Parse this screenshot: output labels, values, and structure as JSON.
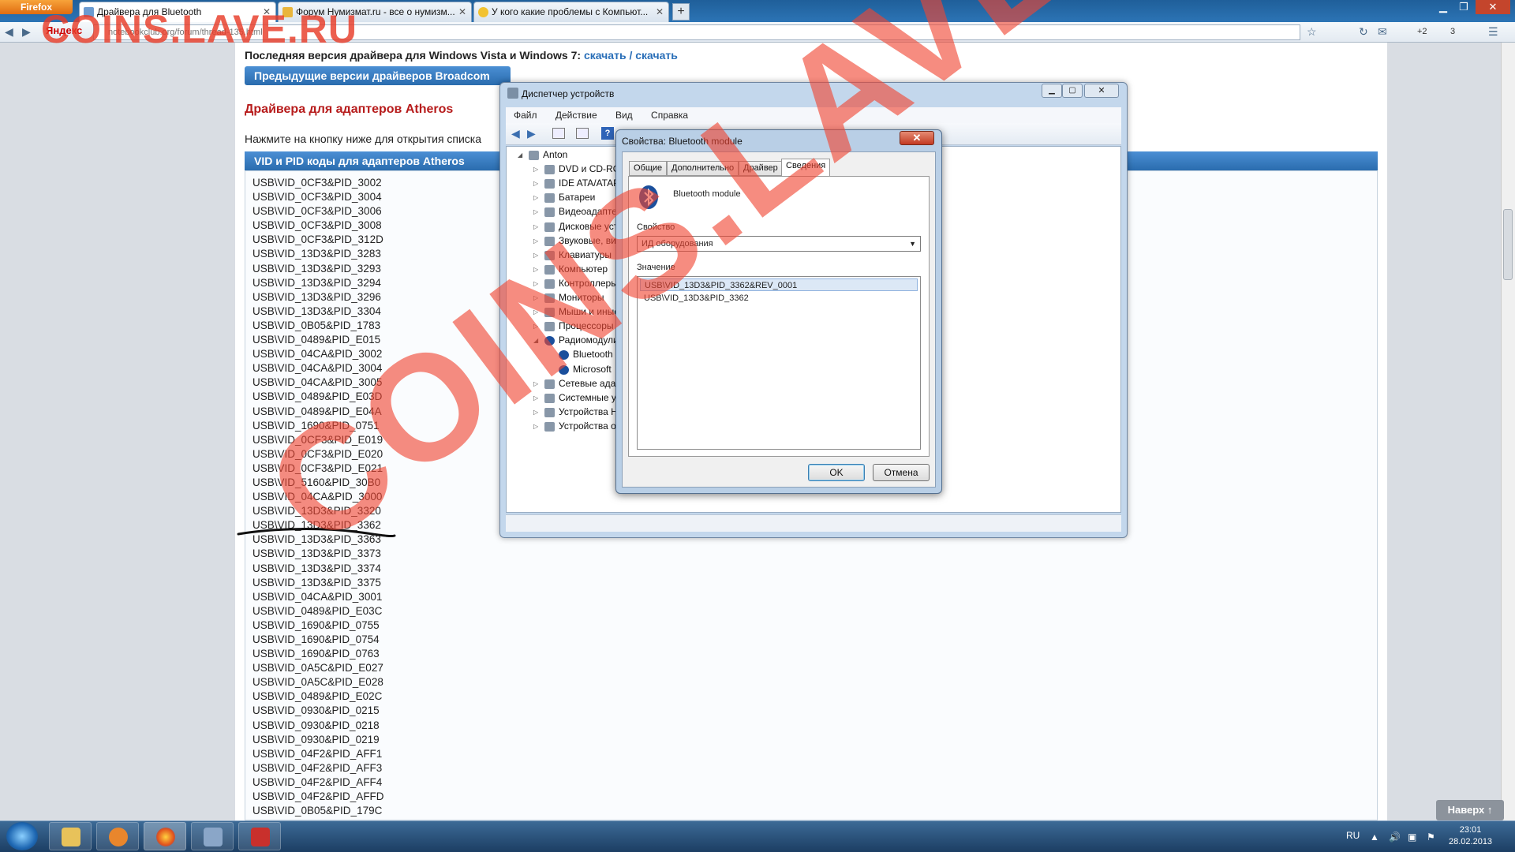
{
  "browser": {
    "menu_button": "Firefox",
    "tabs": [
      {
        "label": "Драйвера для Bluetooth",
        "active": true
      },
      {
        "label": "Форум Нумизмат.ru - все о нумизм...",
        "active": false
      },
      {
        "label": "У кого какие проблемы с Компьют...",
        "active": false
      }
    ],
    "new_tab": "+",
    "search_engine": "Яндекс",
    "url": "notebookclub.org/forum/thread-135.html",
    "toolbar_badges": {
      "plus": "+2",
      "count": "3"
    }
  },
  "page": {
    "latest_label": "Последняя версия драйвера для Windows Vista и Windows 7:",
    "download1": "скачать",
    "separator": "/",
    "download2": "скачать",
    "prev_button": "Предыдущие версии драйверов Broadcom",
    "atheros_heading": "Драйвера для адаптеров Atheros",
    "press_text": "Нажмите на кнопку ниже для открытия списка",
    "vid_bar": "VID и PID коды для адаптеров Atheros",
    "vid_list": [
      "USB\\VID_0CF3&PID_3002",
      "USB\\VID_0CF3&PID_3004",
      "USB\\VID_0CF3&PID_3006",
      "USB\\VID_0CF3&PID_3008",
      "USB\\VID_0CF3&PID_312D",
      "USB\\VID_13D3&PID_3283",
      "USB\\VID_13D3&PID_3293",
      "USB\\VID_13D3&PID_3294",
      "USB\\VID_13D3&PID_3296",
      "USB\\VID_13D3&PID_3304",
      "USB\\VID_0B05&PID_1783",
      "USB\\VID_0489&PID_E015",
      "USB\\VID_04CA&PID_3002",
      "USB\\VID_04CA&PID_3004",
      "USB\\VID_04CA&PID_3005",
      "USB\\VID_0489&PID_E03D",
      "USB\\VID_0489&PID_E04A",
      "USB\\VID_1690&PID_0751",
      "USB\\VID_0CF3&PID_E019",
      "USB\\VID_0CF3&PID_E020",
      "USB\\VID_0CF3&PID_E021",
      "USB\\VID_5160&PID_30B0",
      "USB\\VID_04CA&PID_3000",
      "USB\\VID_13D3&PID_3320",
      "USB\\VID_13D3&PID_3362",
      "USB\\VID_13D3&PID_3363",
      "USB\\VID_13D3&PID_3373",
      "USB\\VID_13D3&PID_3374",
      "USB\\VID_13D3&PID_3375",
      "USB\\VID_04CA&PID_3001",
      "USB\\VID_0489&PID_E03C",
      "USB\\VID_1690&PID_0755",
      "USB\\VID_1690&PID_0754",
      "USB\\VID_1690&PID_0763",
      "USB\\VID_0A5C&PID_E027",
      "USB\\VID_0A5C&PID_E028",
      "USB\\VID_0489&PID_E02C",
      "USB\\VID_0930&PID_0215",
      "USB\\VID_0930&PID_0218",
      "USB\\VID_0930&PID_0219",
      "USB\\VID_04F2&PID_AFF1",
      "USB\\VID_04F2&PID_AFF3",
      "USB\\VID_04F2&PID_AFF4",
      "USB\\VID_04F2&PID_AFFD",
      "USB\\VID_0B05&PID_179C"
    ],
    "scroll_top_button": "Наверх ↑"
  },
  "device_manager": {
    "title": "Диспетчер устройств",
    "menu": [
      "Файл",
      "Действие",
      "Вид",
      "Справка"
    ],
    "tree": [
      {
        "label": "Anton",
        "level": 0
      },
      {
        "label": "DVD и CD-RO",
        "level": 1
      },
      {
        "label": "IDE ATA/ATAP",
        "level": 1
      },
      {
        "label": "Батареи",
        "level": 1
      },
      {
        "label": "Видеоадаптер",
        "level": 1
      },
      {
        "label": "Дисковые уст",
        "level": 1
      },
      {
        "label": "Звуковые, вид",
        "level": 1
      },
      {
        "label": "Клавиатуры",
        "level": 1
      },
      {
        "label": "Компьютер",
        "level": 1
      },
      {
        "label": "Контроллеры",
        "level": 1
      },
      {
        "label": "Мониторы",
        "level": 1
      },
      {
        "label": "Мыши и иные",
        "level": 1
      },
      {
        "label": "Процессоры",
        "level": 1
      },
      {
        "label": "Радиомодули",
        "level": 1
      },
      {
        "label": "Bluetooth",
        "level": 2
      },
      {
        "label": "Microsoft",
        "level": 2
      },
      {
        "label": "Сетевые адап",
        "level": 1
      },
      {
        "label": "Системные у",
        "level": 1
      },
      {
        "label": "Устройства H",
        "level": 1
      },
      {
        "label": "Устройства о",
        "level": 1
      }
    ]
  },
  "properties_dialog": {
    "title": "Свойства: Bluetooth module",
    "close": "✕",
    "tabs": [
      "Общие",
      "Дополнительно",
      "Драйвер",
      "Сведения"
    ],
    "active_tab": "Сведения",
    "device_name": "Bluetooth module",
    "property_label": "Свойство",
    "property_value": "ИД оборудования",
    "value_label": "Значение",
    "values": [
      "USB\\VID_13D3&PID_3362&REV_0001",
      "USB\\VID_13D3&PID_3362"
    ],
    "ok": "OK",
    "cancel": "Отмена"
  },
  "taskbar": {
    "lang": "RU",
    "time": "23:01",
    "date": "28.02.2013"
  },
  "watermark": {
    "top": "COINS.LAVE.RU",
    "big": "COINS.LAVE.RU"
  },
  "colors": {
    "accent": "#2a6cae",
    "heading_red": "#b71c1c",
    "watermark": "#f04632"
  }
}
